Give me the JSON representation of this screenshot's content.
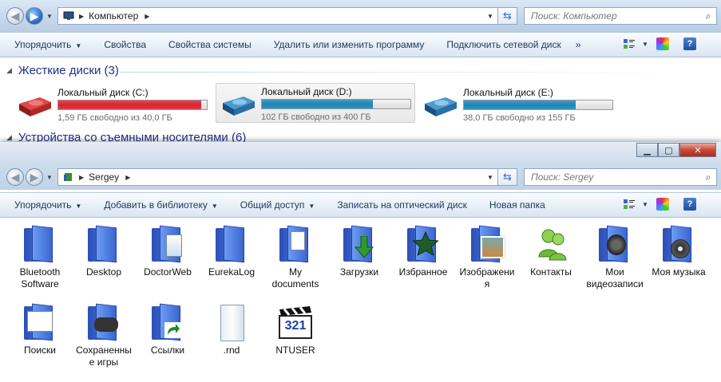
{
  "win1": {
    "address": {
      "crumb": "Компьютер"
    },
    "search": {
      "placeholder": "Поиск: Компьютер"
    },
    "toolbar": {
      "organize": "Упорядочить",
      "properties": "Свойства",
      "system_properties": "Свойства системы",
      "uninstall": "Удалить или изменить программу",
      "map_drive": "Подключить сетевой диск",
      "more": "»"
    },
    "groups": {
      "hard_disks": "Жесткие диски (3)",
      "removable": "Устройства со съемными носителями (6)"
    },
    "drives": [
      {
        "name": "Локальный диск (C:)",
        "info": "1,59 ГБ свободно из 40,0 ГБ",
        "used_fraction": 0.96,
        "color": "#d9232e"
      },
      {
        "name": "Локальный диск (D:)",
        "info": "102 ГБ свободно из 400 ГБ",
        "used_fraction": 0.745,
        "color": "#1b86b8"
      },
      {
        "name": "Локальный диск (E:)",
        "info": "38,0 ГБ свободно из 155 ГБ",
        "used_fraction": 0.755,
        "color": "#1b86b8"
      }
    ]
  },
  "win2": {
    "address": {
      "crumb": "Sergey"
    },
    "search": {
      "placeholder": "Поиск: Sergey"
    },
    "toolbar": {
      "organize": "Упорядочить",
      "add_library": "Добавить в библиотеку",
      "share": "Общий доступ",
      "burn": "Записать на оптический диск",
      "new_folder": "Новая папка"
    },
    "caption": {
      "min": "▁",
      "max": "▢",
      "close": "✕"
    },
    "items": [
      {
        "label": "Bluetooth Software",
        "type": "folder"
      },
      {
        "label": "Desktop",
        "type": "folder"
      },
      {
        "label": "DoctorWeb",
        "type": "folder"
      },
      {
        "label": "EurekaLog",
        "type": "folder"
      },
      {
        "label": "My documents",
        "type": "folder"
      },
      {
        "label": "Загрузки",
        "type": "folder"
      },
      {
        "label": "Избранное",
        "type": "folder"
      },
      {
        "label": "Изображения",
        "type": "folder"
      },
      {
        "label": "Контакты",
        "type": "folder"
      },
      {
        "label": "Мои видеозаписи",
        "type": "folder"
      },
      {
        "label": "Моя музыка",
        "type": "folder"
      },
      {
        "label": "Поиски",
        "type": "folder"
      },
      {
        "label": "Сохраненные игры",
        "type": "folder"
      },
      {
        "label": "Ссылки",
        "type": "folder"
      },
      {
        "label": ".rnd",
        "type": "file"
      },
      {
        "label": "NTUSER",
        "type": "app"
      }
    ],
    "ntuser_text": "321"
  },
  "colors": {
    "accent": "#1e395b",
    "group_heading": "#1e3287"
  }
}
